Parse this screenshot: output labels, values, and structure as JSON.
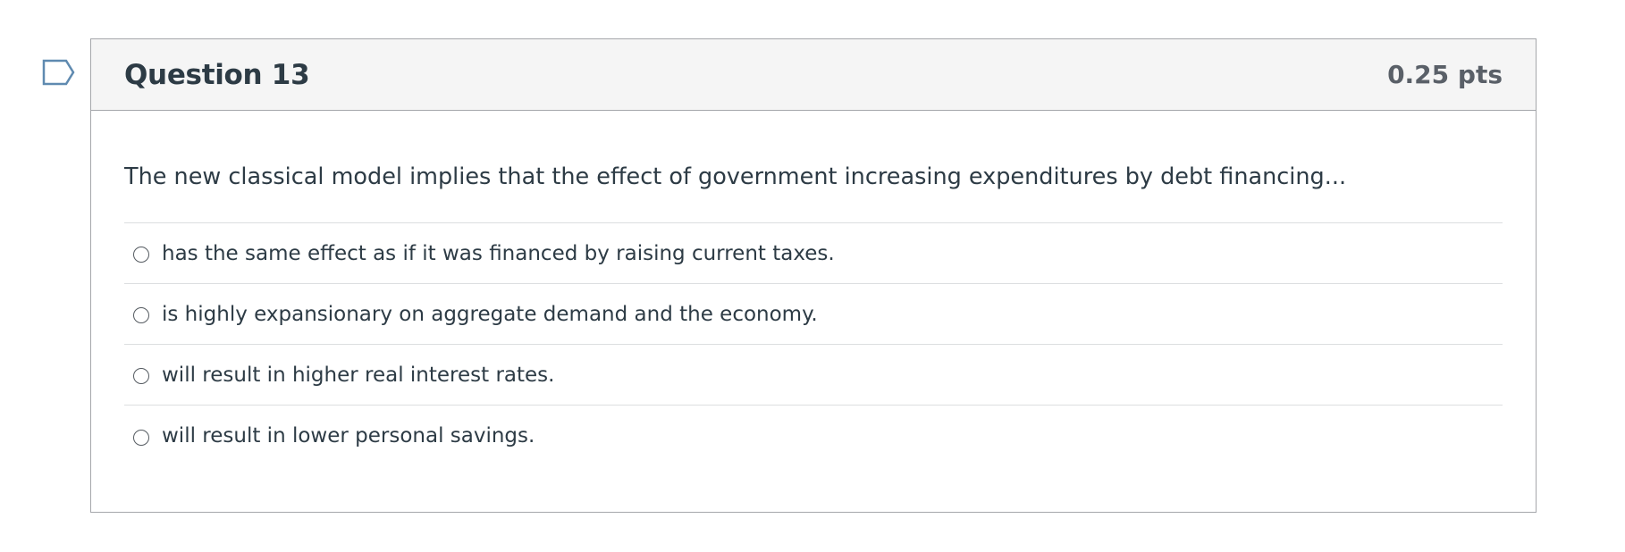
{
  "question": {
    "title": "Question 13",
    "points": "0.25 pts",
    "text": "The new classical model implies that the effect of government increasing expenditures by debt financing...",
    "answers": [
      {
        "label": "has the same effect as if it was financed by raising current taxes."
      },
      {
        "label": "is highly expansionary on aggregate demand and the economy."
      },
      {
        "label": "will result in higher real interest rates."
      },
      {
        "label": "will result in lower personal savings."
      }
    ]
  },
  "icons": {
    "flag": "flag-question-icon"
  },
  "colors": {
    "text": "#2d3b45",
    "header_bg": "#f5f5f5",
    "border": "#a5a7ab",
    "flag_outline": "#5f8ab0"
  }
}
